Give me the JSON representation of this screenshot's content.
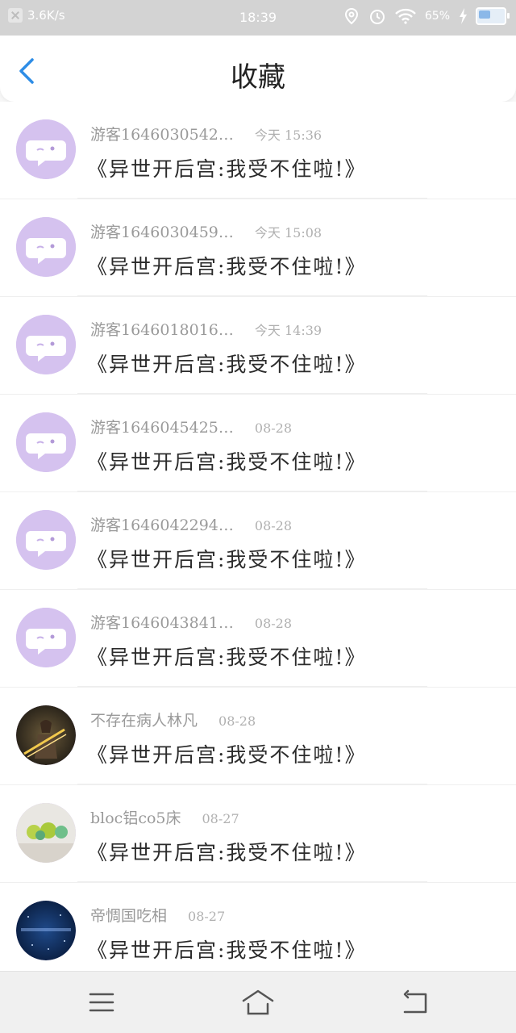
{
  "status_bar": {
    "speed": "3.6K/s",
    "time": "18:39",
    "battery": "65%"
  },
  "header": {
    "title": "收藏",
    "back_icon": "chevron-left-icon"
  },
  "favorites": [
    {
      "user": "游客1646030542…",
      "time": "今天 15:36",
      "book": "《异世开后宫:我受不住啦!》",
      "avatar": "chat-bubble"
    },
    {
      "user": "游客1646030459…",
      "time": "今天 15:08",
      "book": "《异世开后宫:我受不住啦!》",
      "avatar": "chat-bubble"
    },
    {
      "user": "游客1646018016…",
      "time": "今天 14:39",
      "book": "《异世开后宫:我受不住啦!》",
      "avatar": "chat-bubble"
    },
    {
      "user": "游客1646045425…",
      "time": "08-28",
      "book": "《异世开后宫:我受不住啦!》",
      "avatar": "chat-bubble"
    },
    {
      "user": "游客1646042294…",
      "time": "08-28",
      "book": "《异世开后宫:我受不住啦!》",
      "avatar": "chat-bubble"
    },
    {
      "user": "游客1646043841…",
      "time": "08-28",
      "book": "《异世开后宫:我受不住啦!》",
      "avatar": "chat-bubble"
    },
    {
      "user": "不存在病人林凡",
      "time": "08-28",
      "book": "《异世开后宫:我受不住啦!》",
      "avatar": "photo-warrior"
    },
    {
      "user": "bloc铝co5床",
      "time": "08-27",
      "book": "《异世开后宫:我受不住啦!》",
      "avatar": "photo-fruit"
    },
    {
      "user": "帝惆国吃相",
      "time": "08-27",
      "book": "《异世开后宫:我受不住啦!》",
      "avatar": "photo-stars"
    }
  ],
  "nav": {
    "menu_icon": "menu-icon",
    "home_icon": "home-icon",
    "back_icon": "back-icon"
  },
  "colors": {
    "accent": "#2e8de6",
    "avatar_bg": "#d5c2ef"
  }
}
